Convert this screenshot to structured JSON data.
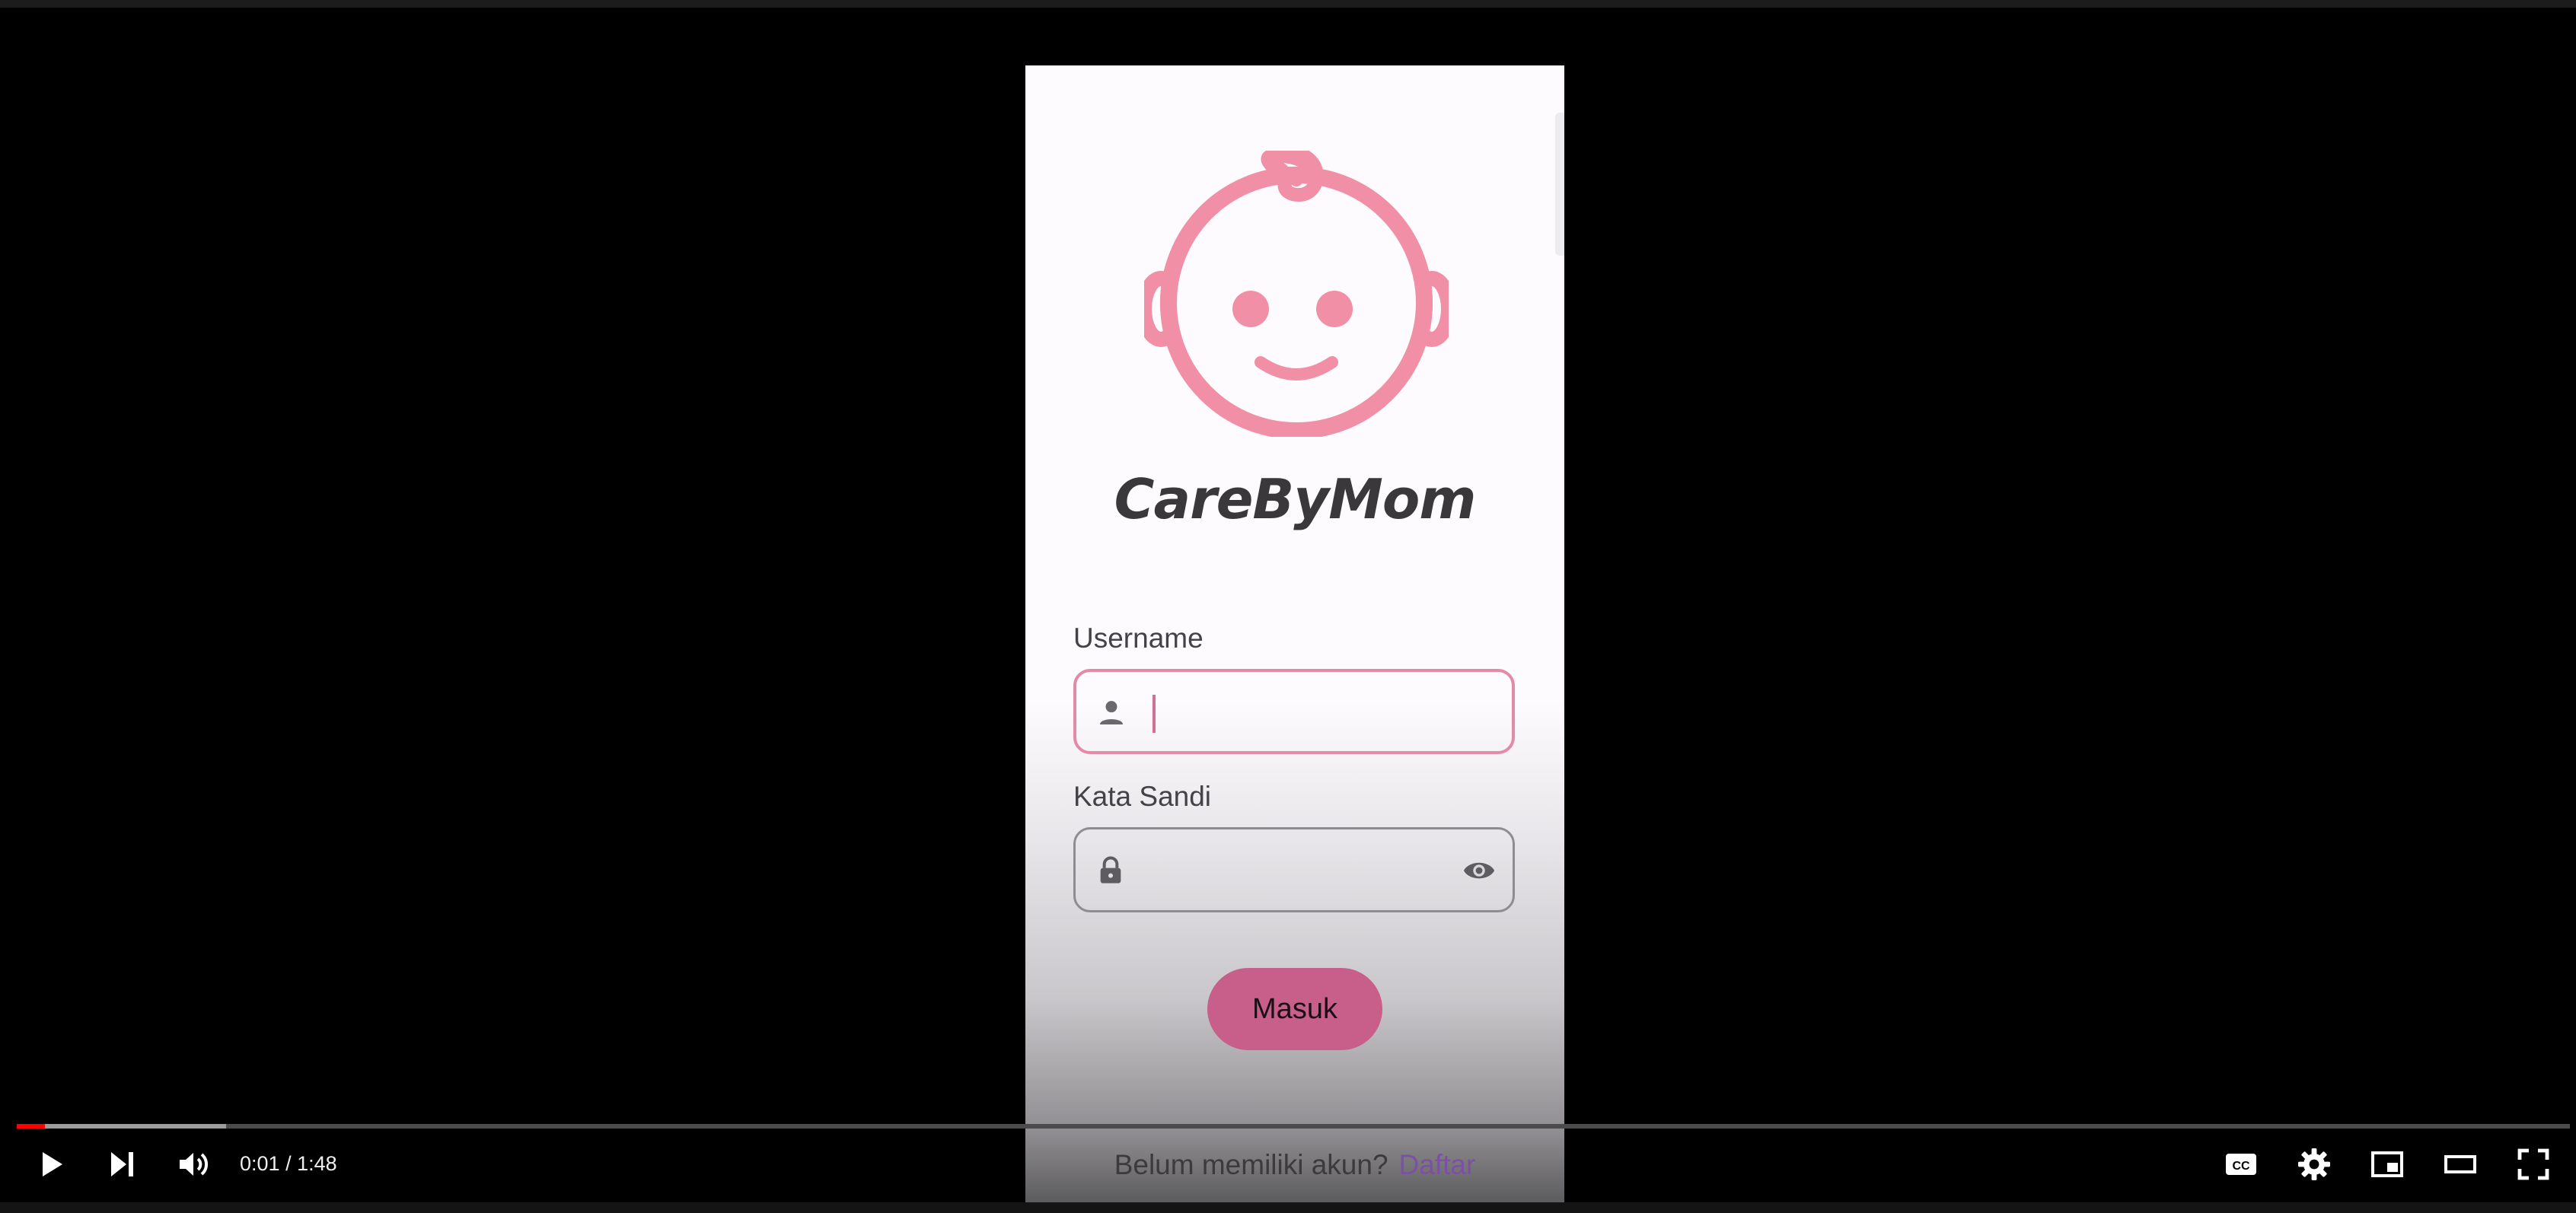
{
  "app": {
    "brand_name": "CareByMom"
  },
  "login_form": {
    "username_label": "Username",
    "username_value": "",
    "password_label": "Kata Sandi",
    "password_value": "",
    "submit_label": "Masuk",
    "register_prompt": "Belum memiliki akun?",
    "register_link": "Daftar"
  },
  "video_player": {
    "current_time": "0:01",
    "separator": " / ",
    "duration": "1:48",
    "played_fraction": 0.011,
    "buffered_fraction": 0.082
  },
  "colors": {
    "accent_pink": "#e48aa6",
    "logo_pink": "#f08fa5",
    "button": "#c85f8b",
    "link_purple": "#7c50a4",
    "progress_played": "#ff0000"
  },
  "icons": {
    "logo": "baby-face-logo",
    "username": "person-icon",
    "password": "lock-icon",
    "password_toggle": "eye-icon",
    "player": [
      "play-icon",
      "next-icon",
      "volume-icon",
      "captions-icon",
      "settings-icon",
      "miniplayer-icon",
      "theater-icon",
      "fullscreen-icon"
    ],
    "system_nav": [
      "back-icon",
      "home-icon",
      "recents-icon"
    ]
  }
}
